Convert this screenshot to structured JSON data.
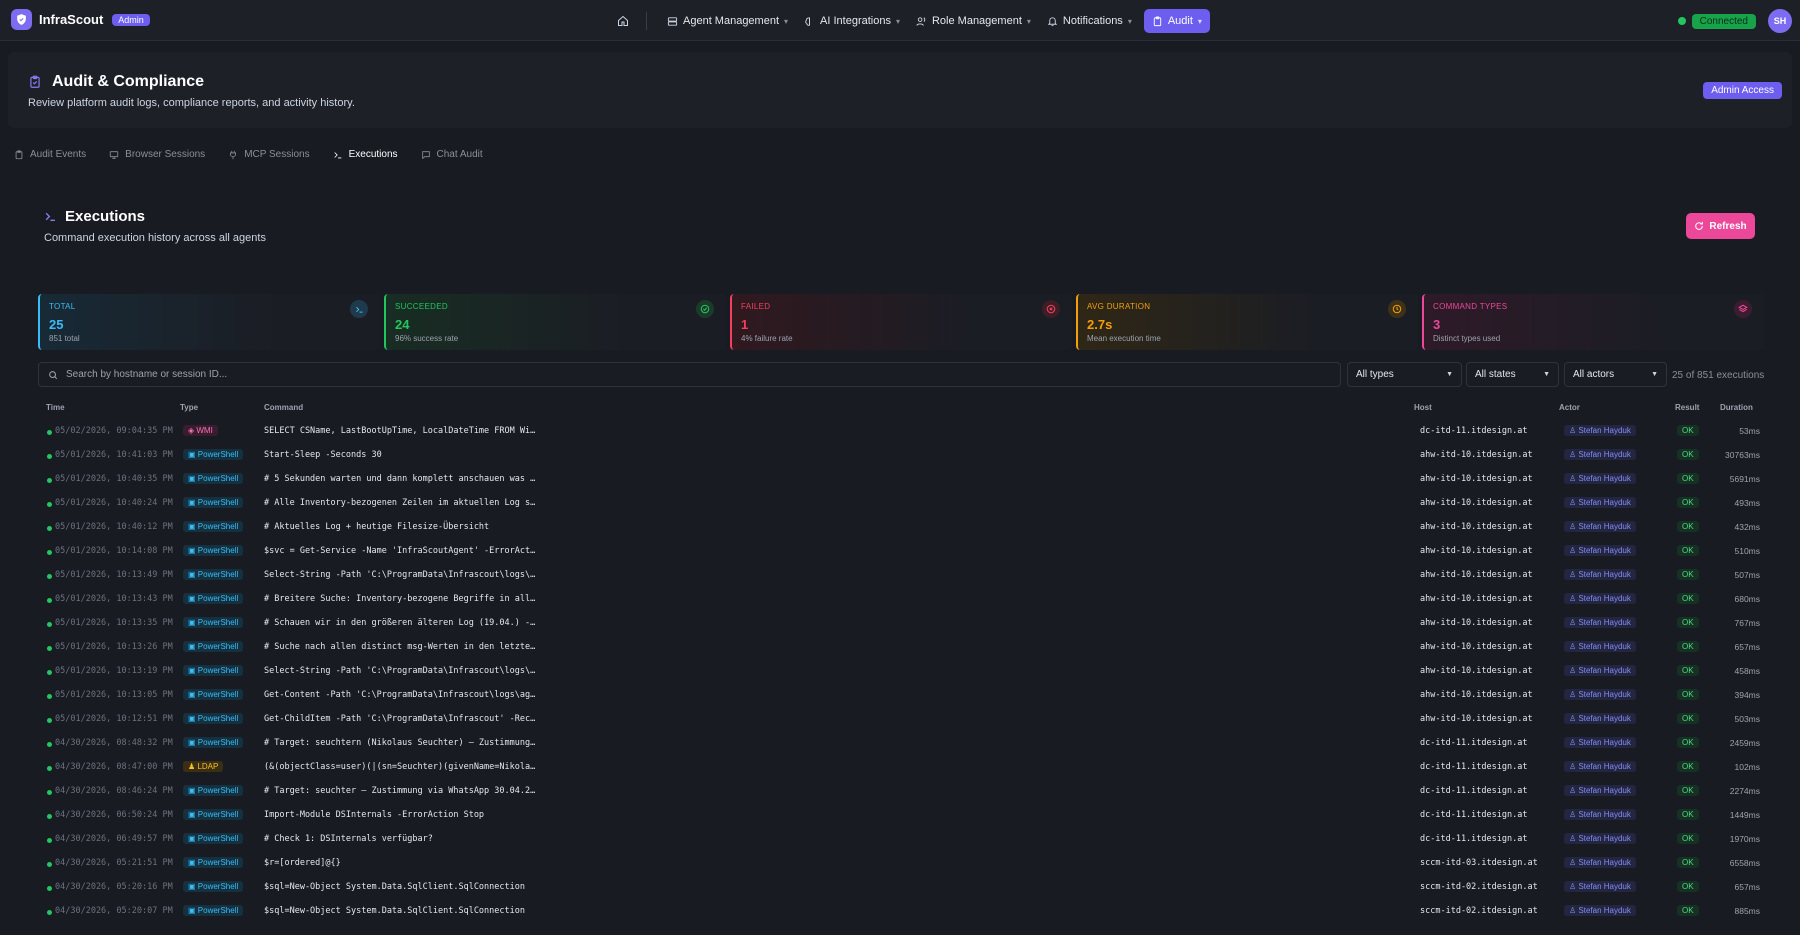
{
  "brand": {
    "name": "InfraScout",
    "badge": "Admin"
  },
  "nav": {
    "items": [
      {
        "label": "Agent Management",
        "icon": "server-icon"
      },
      {
        "label": "AI Integrations",
        "icon": "brain-icon"
      },
      {
        "label": "Role Management",
        "icon": "users-icon"
      },
      {
        "label": "Notifications",
        "icon": "bell-icon"
      },
      {
        "label": "Audit",
        "icon": "clipboard-icon",
        "active": true
      }
    ],
    "status": "Connected",
    "avatar_initials": "SH"
  },
  "page": {
    "title": "Audit & Compliance",
    "subtitle": "Review platform audit logs, compliance reports, and activity history.",
    "access_badge": "Admin Access"
  },
  "tabs": [
    {
      "label": "Audit Events"
    },
    {
      "label": "Browser Sessions"
    },
    {
      "label": "MCP Sessions"
    },
    {
      "label": "Executions",
      "active": true
    },
    {
      "label": "Chat Audit"
    }
  ],
  "executions": {
    "title": "Executions",
    "subtitle": "Command execution history across all agents",
    "refresh_label": "Refresh"
  },
  "stats": [
    {
      "label": "TOTAL",
      "value": "25",
      "sub": "851 total",
      "color": "#38bdf8"
    },
    {
      "label": "SUCCEEDED",
      "value": "24",
      "sub": "96% success rate",
      "color": "#22c55e"
    },
    {
      "label": "FAILED",
      "value": "1",
      "sub": "4% failure rate",
      "color": "#f43f5e"
    },
    {
      "label": "AVG DURATION",
      "value": "2.7s",
      "sub": "Mean execution time",
      "color": "#f59e0b"
    },
    {
      "label": "COMMAND TYPES",
      "value": "3",
      "sub": "Distinct types used",
      "color": "#ec4899"
    }
  ],
  "filters": {
    "search_placeholder": "Search by hostname or session ID...",
    "type": "All types",
    "state": "All states",
    "actor": "All actors",
    "count_text": "25 of 851 executions"
  },
  "table": {
    "headers": {
      "time": "Time",
      "type": "Type",
      "command": "Command",
      "host": "Host",
      "actor": "Actor",
      "result": "Result",
      "duration": "Duration"
    },
    "rows": [
      {
        "time": "05/02/2026, 09:04:35 PM",
        "type": "WMI",
        "command": "SELECT CSName, LastBootUpTime, LocalDateTime FROM Wi…",
        "host": "dc-itd-11.itdesign.at",
        "actor": "Stefan Hayduk",
        "result": "OK",
        "duration": "53ms"
      },
      {
        "time": "05/01/2026, 10:41:03 PM",
        "type": "PowerShell",
        "command": "Start-Sleep -Seconds 30",
        "host": "ahw-itd-10.itdesign.at",
        "actor": "Stefan Hayduk",
        "result": "OK",
        "duration": "30763ms"
      },
      {
        "time": "05/01/2026, 10:40:35 PM",
        "type": "PowerShell",
        "command": "# 5 Sekunden warten und dann komplett anschauen was …",
        "host": "ahw-itd-10.itdesign.at",
        "actor": "Stefan Hayduk",
        "result": "OK",
        "duration": "5691ms"
      },
      {
        "time": "05/01/2026, 10:40:24 PM",
        "type": "PowerShell",
        "command": "# Alle Inventory-bezogenen Zeilen im aktuellen Log s…",
        "host": "ahw-itd-10.itdesign.at",
        "actor": "Stefan Hayduk",
        "result": "OK",
        "duration": "493ms"
      },
      {
        "time": "05/01/2026, 10:40:12 PM",
        "type": "PowerShell",
        "command": "# Aktuelles Log + heutige Filesize-Übersicht",
        "host": "ahw-itd-10.itdesign.at",
        "actor": "Stefan Hayduk",
        "result": "OK",
        "duration": "432ms"
      },
      {
        "time": "05/01/2026, 10:14:08 PM",
        "type": "PowerShell",
        "command": "$svc = Get-Service -Name 'InfraScoutAgent' -ErrorAct…",
        "host": "ahw-itd-10.itdesign.at",
        "actor": "Stefan Hayduk",
        "result": "OK",
        "duration": "510ms"
      },
      {
        "time": "05/01/2026, 10:13:49 PM",
        "type": "PowerShell",
        "command": "Select-String -Path 'C:\\ProgramData\\Infrascout\\logs\\…",
        "host": "ahw-itd-10.itdesign.at",
        "actor": "Stefan Hayduk",
        "result": "OK",
        "duration": "507ms"
      },
      {
        "time": "05/01/2026, 10:13:43 PM",
        "type": "PowerShell",
        "command": "# Breitere Suche: Inventory-bezogene Begriffe in all…",
        "host": "ahw-itd-10.itdesign.at",
        "actor": "Stefan Hayduk",
        "result": "OK",
        "duration": "680ms"
      },
      {
        "time": "05/01/2026, 10:13:35 PM",
        "type": "PowerShell",
        "command": "# Schauen wir in den größeren älteren Log (19.04.) -…",
        "host": "ahw-itd-10.itdesign.at",
        "actor": "Stefan Hayduk",
        "result": "OK",
        "duration": "767ms"
      },
      {
        "time": "05/01/2026, 10:13:26 PM",
        "type": "PowerShell",
        "command": "# Suche nach allen distinct msg-Werten in den letzte…",
        "host": "ahw-itd-10.itdesign.at",
        "actor": "Stefan Hayduk",
        "result": "OK",
        "duration": "657ms"
      },
      {
        "time": "05/01/2026, 10:13:19 PM",
        "type": "PowerShell",
        "command": "Select-String -Path 'C:\\ProgramData\\Infrascout\\logs\\…",
        "host": "ahw-itd-10.itdesign.at",
        "actor": "Stefan Hayduk",
        "result": "OK",
        "duration": "458ms"
      },
      {
        "time": "05/01/2026, 10:13:05 PM",
        "type": "PowerShell",
        "command": "Get-Content -Path 'C:\\ProgramData\\Infrascout\\logs\\ag…",
        "host": "ahw-itd-10.itdesign.at",
        "actor": "Stefan Hayduk",
        "result": "OK",
        "duration": "394ms"
      },
      {
        "time": "05/01/2026, 10:12:51 PM",
        "type": "PowerShell",
        "command": "Get-ChildItem -Path 'C:\\ProgramData\\Infrascout' -Rec…",
        "host": "ahw-itd-10.itdesign.at",
        "actor": "Stefan Hayduk",
        "result": "OK",
        "duration": "503ms"
      },
      {
        "time": "04/30/2026, 08:48:32 PM",
        "type": "PowerShell",
        "command": "# Target: seuchtern (Nikolaus Seuchter) — Zustimmung…",
        "host": "dc-itd-11.itdesign.at",
        "actor": "Stefan Hayduk",
        "result": "OK",
        "duration": "2459ms"
      },
      {
        "time": "04/30/2026, 08:47:00 PM",
        "type": "LDAP",
        "command": "(&(objectClass=user)(|(sn=Seuchter)(givenName=Nikola…",
        "host": "dc-itd-11.itdesign.at",
        "actor": "Stefan Hayduk",
        "result": "OK",
        "duration": "102ms"
      },
      {
        "time": "04/30/2026, 08:46:24 PM",
        "type": "PowerShell",
        "command": "# Target: seuchter — Zustimmung via WhatsApp 30.04.2…",
        "host": "dc-itd-11.itdesign.at",
        "actor": "Stefan Hayduk",
        "result": "OK",
        "duration": "2274ms"
      },
      {
        "time": "04/30/2026, 06:50:24 PM",
        "type": "PowerShell",
        "command": "Import-Module DSInternals -ErrorAction Stop",
        "host": "dc-itd-11.itdesign.at",
        "actor": "Stefan Hayduk",
        "result": "OK",
        "duration": "1449ms"
      },
      {
        "time": "04/30/2026, 06:49:57 PM",
        "type": "PowerShell",
        "command": "# Check 1: DSInternals verfügbar?",
        "host": "dc-itd-11.itdesign.at",
        "actor": "Stefan Hayduk",
        "result": "OK",
        "duration": "1970ms"
      },
      {
        "time": "04/30/2026, 05:21:51 PM",
        "type": "PowerShell",
        "command": "$r=[ordered]@{}",
        "host": "sccm-itd-03.itdesign.at",
        "actor": "Stefan Hayduk",
        "result": "OK",
        "duration": "6558ms"
      },
      {
        "time": "04/30/2026, 05:20:16 PM",
        "type": "PowerShell",
        "command": "$sql=New-Object System.Data.SqlClient.SqlConnection",
        "host": "sccm-itd-02.itdesign.at",
        "actor": "Stefan Hayduk",
        "result": "OK",
        "duration": "657ms"
      },
      {
        "time": "04/30/2026, 05:20:07 PM",
        "type": "PowerShell",
        "command": "$sql=New-Object System.Data.SqlClient.SqlConnection",
        "host": "sccm-itd-02.itdesign.at",
        "actor": "Stefan Hayduk",
        "result": "OK",
        "duration": "885ms"
      }
    ]
  }
}
